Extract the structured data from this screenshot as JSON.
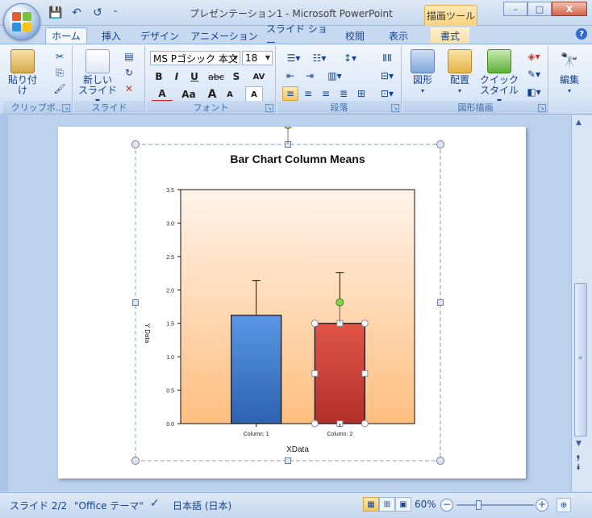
{
  "window": {
    "title": "プレゼンテーション1 - Microsoft PowerPoint",
    "contextual_tab_group": "描画ツール",
    "controls": {
      "minimize": "–",
      "maximize": "□",
      "close": "X"
    }
  },
  "qat": {
    "save": "💾",
    "undo": "↶",
    "redo": "↺",
    "customize": "⁼"
  },
  "tabs": [
    {
      "label": "ホーム"
    },
    {
      "label": "挿入"
    },
    {
      "label": "デザイン"
    },
    {
      "label": "アニメーション"
    },
    {
      "label": "スライド ショー"
    },
    {
      "label": "校閲"
    },
    {
      "label": "表示"
    },
    {
      "label": "書式"
    }
  ],
  "ribbon": {
    "clipboard": {
      "label": "クリップボ...",
      "paste": "貼り付け",
      "cut": "✂",
      "copy": "⎘",
      "format_painter": "🖌"
    },
    "slides": {
      "label": "スライド",
      "new_slide": "新しい",
      "new_slide_2": "スライド ▾",
      "layout": "▤",
      "reset": "↻",
      "delete": "✕"
    },
    "font": {
      "label": "フォント",
      "font_name": "MS Pゴシック 本文",
      "font_size": "18",
      "bold": "B",
      "italic": "I",
      "underline": "U",
      "strike": "abc",
      "shadow": "S",
      "spacing": "AV",
      "color": "A",
      "case": "Aa",
      "grow": "A",
      "shrink": "A",
      "clear": "A"
    },
    "paragraph": {
      "label": "段落"
    },
    "drawing": {
      "label": "図形描画",
      "shapes": "図形",
      "arrange": "配置",
      "quick_style_1": "クイック",
      "quick_style_2": "スタイル ▾"
    },
    "editing": {
      "label": "編集",
      "icon": "🔭"
    }
  },
  "chart_data": {
    "type": "bar",
    "title": "Bar Chart Column Means",
    "xlabel": "XData",
    "ylabel": "Y Data",
    "categories": [
      "Column: 1",
      "Column: 2"
    ],
    "values": [
      1.62,
      1.5
    ],
    "errors": [
      0.52,
      0.76
    ],
    "ylim": [
      0,
      3.5
    ],
    "yticks": [
      "0.0",
      "0.5",
      "1.0",
      "1.5",
      "2.0",
      "2.5",
      "3.0",
      "3.5"
    ],
    "grid": false,
    "bar_colors": [
      "#3d7bd0",
      "#d3413a"
    ],
    "background": [
      "#fff3ea",
      "#ffbf80"
    ]
  },
  "status": {
    "slide": "スライド 2/2",
    "theme": "\"Office テーマ\"",
    "language": "日本語 (日本)",
    "zoom": "60%",
    "zoom_minus": "−",
    "zoom_plus": "+"
  }
}
